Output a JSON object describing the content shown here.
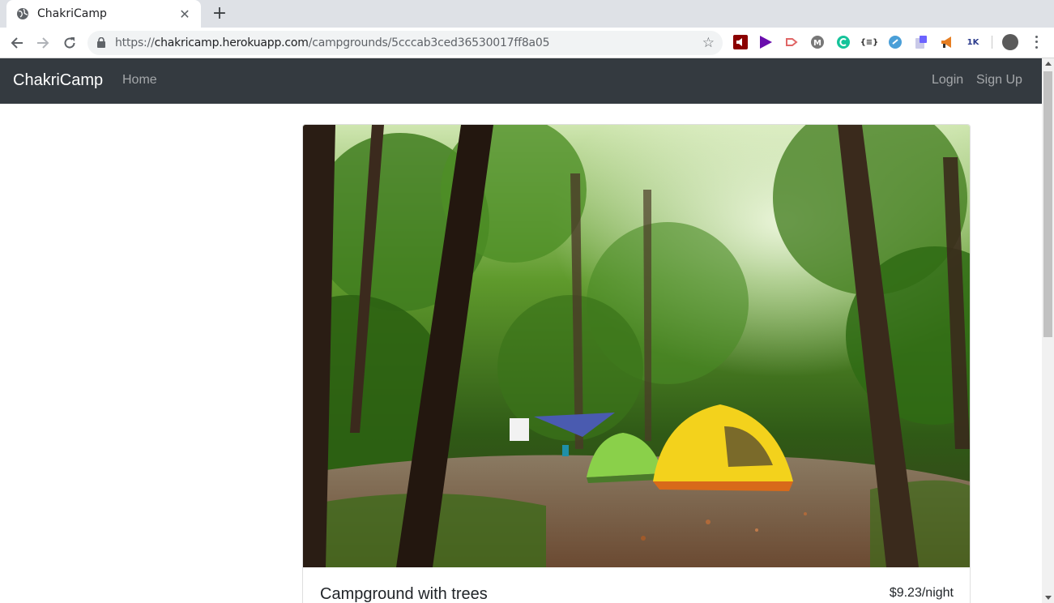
{
  "browser": {
    "tab_title": "ChakriCamp",
    "tab_close": "✕",
    "new_tab": "+",
    "url_scheme": "https://",
    "url_host": "chakricamp.herokuapp.com",
    "url_path": "/campgrounds/5cccab3ced36530017ff8a05",
    "bookmark_icon": "star-icon",
    "extensions": [
      {
        "name": "speaker-extension-icon",
        "color": "#8b0000"
      },
      {
        "name": "play-extension-icon",
        "color": "#6a0dad"
      },
      {
        "name": "arrow-extension-icon",
        "color": "#e06666"
      },
      {
        "name": "m-extension-icon",
        "color": "#777777"
      },
      {
        "name": "grammarly-extension-icon",
        "color": "#15c39a"
      },
      {
        "name": "json-extension-icon",
        "color": "#333333"
      },
      {
        "name": "link-extension-icon",
        "color": "#4a9fd8"
      },
      {
        "name": "clipboard-extension-icon",
        "color": "#6c63ff"
      },
      {
        "name": "megaphone-extension-icon",
        "color": "#e67e22"
      },
      {
        "name": "1k-extension-icon",
        "color": "#2b3a8c"
      }
    ],
    "ext_1k_label": "1K",
    "ext_json_label": "{≡}"
  },
  "navbar": {
    "brand": "ChakriCamp",
    "home": "Home",
    "login": "Login",
    "signup": "Sign Up"
  },
  "campground": {
    "name": "Campground with trees",
    "price": "$9.23/night",
    "image_alt": "forest campsite with tents"
  },
  "colors": {
    "navbar_bg": "#343a40",
    "tabstrip_bg": "#dee1e6"
  }
}
